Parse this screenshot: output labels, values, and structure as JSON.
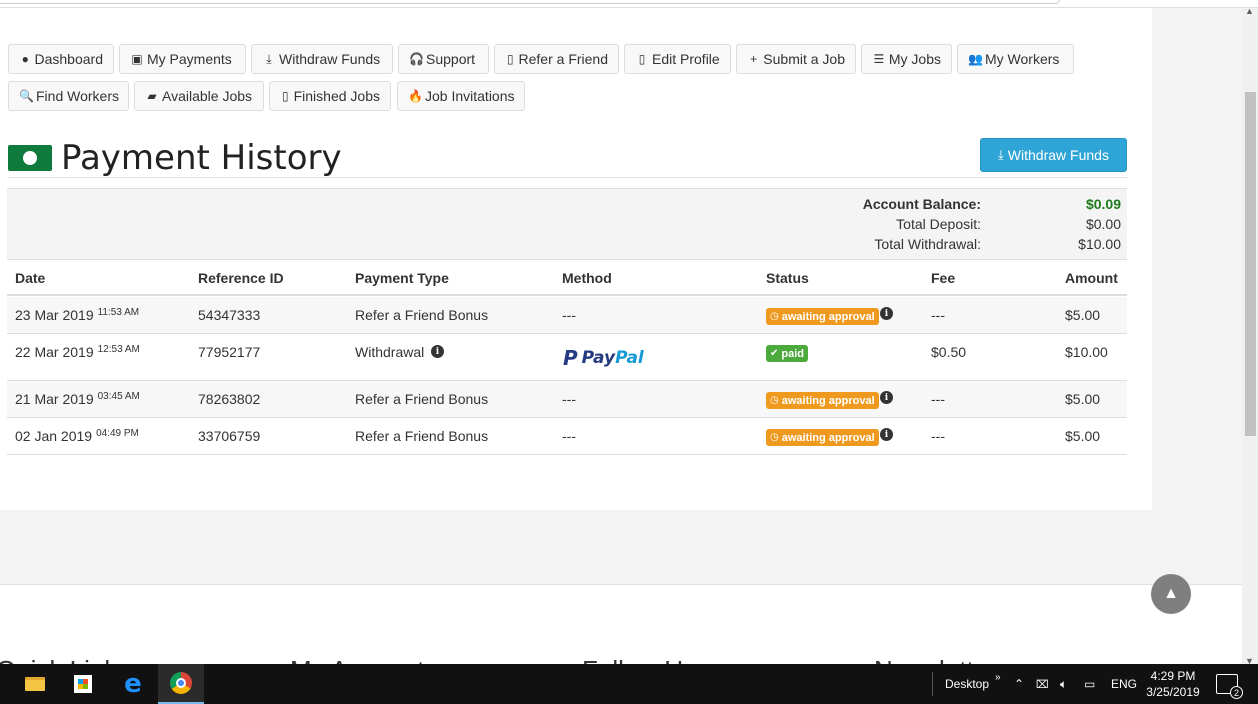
{
  "nav": {
    "row1": [
      {
        "icon": "user-circle-icon",
        "glyph": "●",
        "label": "Dashboard"
      },
      {
        "icon": "money-icon",
        "glyph": "▣",
        "label": "My Payments"
      },
      {
        "icon": "download-icon",
        "glyph": "⤓",
        "label": "Withdraw Funds"
      },
      {
        "icon": "headset-icon",
        "glyph": "🎧",
        "label": "Support"
      },
      {
        "icon": "missing-glyph-icon",
        "glyph": "▯",
        "label": "Refer a Friend"
      },
      {
        "icon": "missing-glyph-icon",
        "glyph": "▯",
        "label": "Edit Profile"
      },
      {
        "icon": "plus-icon",
        "glyph": "+",
        "label": "Submit a Job"
      },
      {
        "icon": "list-icon",
        "glyph": "☰",
        "label": "My Jobs"
      },
      {
        "icon": "users-icon",
        "glyph": "👥",
        "label": "My Workers"
      }
    ],
    "row2": [
      {
        "icon": "search-icon",
        "glyph": "🔍",
        "label": "Find Workers"
      },
      {
        "icon": "briefcase-icon",
        "glyph": "▰",
        "label": "Available Jobs"
      },
      {
        "icon": "missing-glyph-icon",
        "glyph": "▯",
        "label": "Finished Jobs"
      },
      {
        "icon": "fire-icon",
        "glyph": "🔥",
        "label": "Job Invitations"
      }
    ]
  },
  "page": {
    "title": "Payment History",
    "withdraw_button": "Withdraw Funds"
  },
  "summary": {
    "balance_label": "Account Balance:",
    "balance_value": "$0.09",
    "deposit_label": "Total Deposit:",
    "deposit_value": "$0.00",
    "withdrawal_label": "Total Withdrawal:",
    "withdrawal_value": "$10.00"
  },
  "table": {
    "headers": {
      "date": "Date",
      "ref": "Reference ID",
      "type": "Payment Type",
      "method": "Method",
      "status": "Status",
      "fee": "Fee",
      "amount": "Amount"
    },
    "rows": [
      {
        "date": "23 Mar 2019",
        "time": "11:53 AM",
        "ref": "54347333",
        "type": "Refer a Friend Bonus",
        "type_info": false,
        "method": "---",
        "status": "awaiting approval",
        "status_kind": "warn",
        "status_info": true,
        "fee": "---",
        "amount": "$5.00"
      },
      {
        "date": "22 Mar 2019",
        "time": "12:53 AM",
        "ref": "77952177",
        "type": "Withdrawal",
        "type_info": true,
        "method": "PayPal",
        "status": "paid",
        "status_kind": "ok",
        "status_info": false,
        "fee": "$0.50",
        "amount": "$10.00"
      },
      {
        "date": "21 Mar 2019",
        "time": "03:45 AM",
        "ref": "78263802",
        "type": "Refer a Friend Bonus",
        "type_info": false,
        "method": "---",
        "status": "awaiting approval",
        "status_kind": "warn",
        "status_info": true,
        "fee": "---",
        "amount": "$5.00"
      },
      {
        "date": "02 Jan 2019",
        "time": "04:49 PM",
        "ref": "33706759",
        "type": "Refer a Friend Bonus",
        "type_info": false,
        "method": "---",
        "status": "awaiting approval",
        "status_kind": "warn",
        "status_info": true,
        "fee": "---",
        "amount": "$5.00"
      }
    ]
  },
  "paypal": {
    "part1": "Pay",
    "part2": "Pal"
  },
  "footer": {
    "headings": [
      "Quick Links",
      "My Account",
      "Follow Us",
      "Newsletter"
    ]
  },
  "taskbar": {
    "desktop_label": "Desktop",
    "lang": "ENG",
    "time": "4:29 PM",
    "date": "3/25/2019",
    "notifications": "2"
  },
  "colors": {
    "withdraw_button": "#2fa4d6",
    "badge_warn": "#ef9a1e",
    "badge_ok": "#4caa3c",
    "balance_value": "#1f7a1f"
  }
}
